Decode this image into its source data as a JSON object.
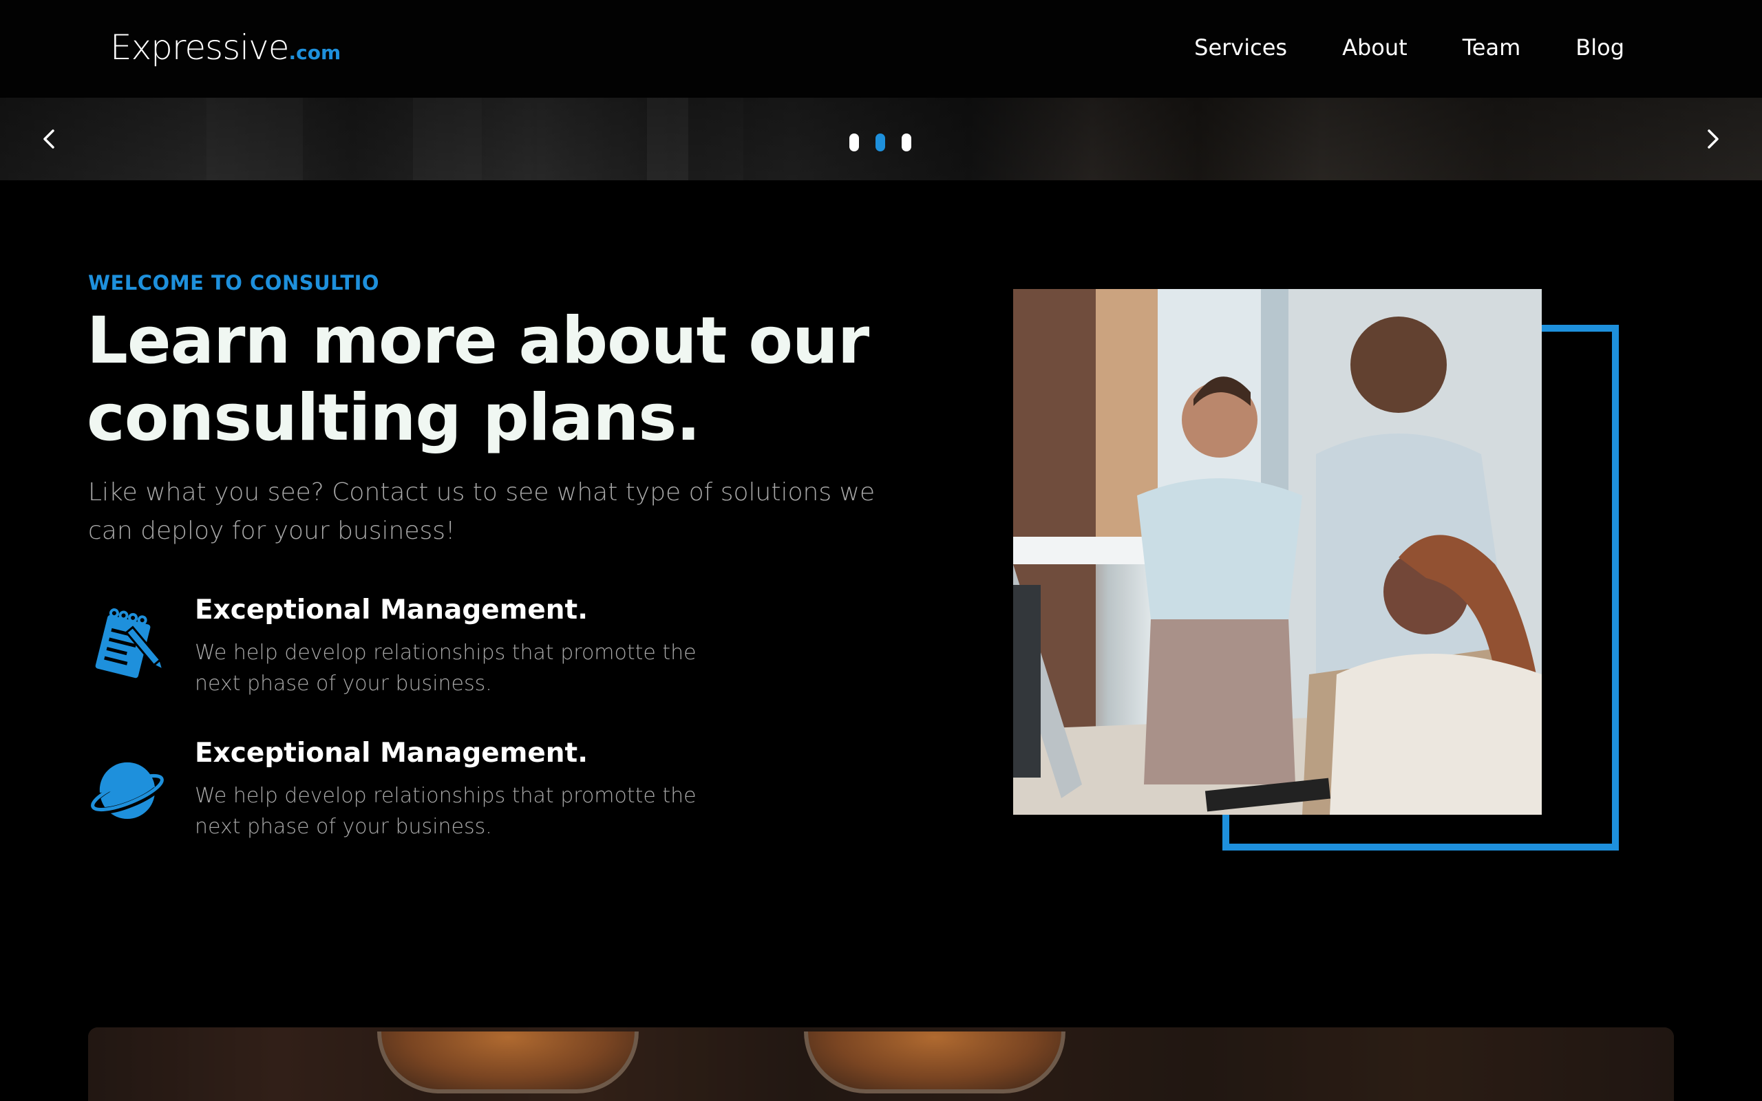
{
  "brand": {
    "name": "Expressive",
    "tld": ".com",
    "accent": "#1e90dc"
  },
  "nav": {
    "items": [
      {
        "label": "Services"
      },
      {
        "label": "About"
      },
      {
        "label": "Team"
      },
      {
        "label": "Blog"
      }
    ]
  },
  "slider": {
    "prev_icon": "chevron-left-icon",
    "next_icon": "chevron-right-icon",
    "dots": 3,
    "active_dot": 2
  },
  "intro": {
    "eyebrow": "WELCOME TO CONSULTIO",
    "headline_line1": "Learn more about our",
    "headline_line2": "consulting plans.",
    "subtext": "Like what you see? Contact us to see what type of solutions we can deploy for your business!"
  },
  "features": [
    {
      "icon": "notepad-pencil-icon",
      "title": "Exceptional Management.",
      "description": "We help develop relationships that promotte the next phase of your business."
    },
    {
      "icon": "planet-icon",
      "title": "Exceptional Management.",
      "description": "We help develop relationships that promotte the next phase of your business."
    }
  ],
  "photo": {
    "subject": "three colleagues working at a computer"
  }
}
